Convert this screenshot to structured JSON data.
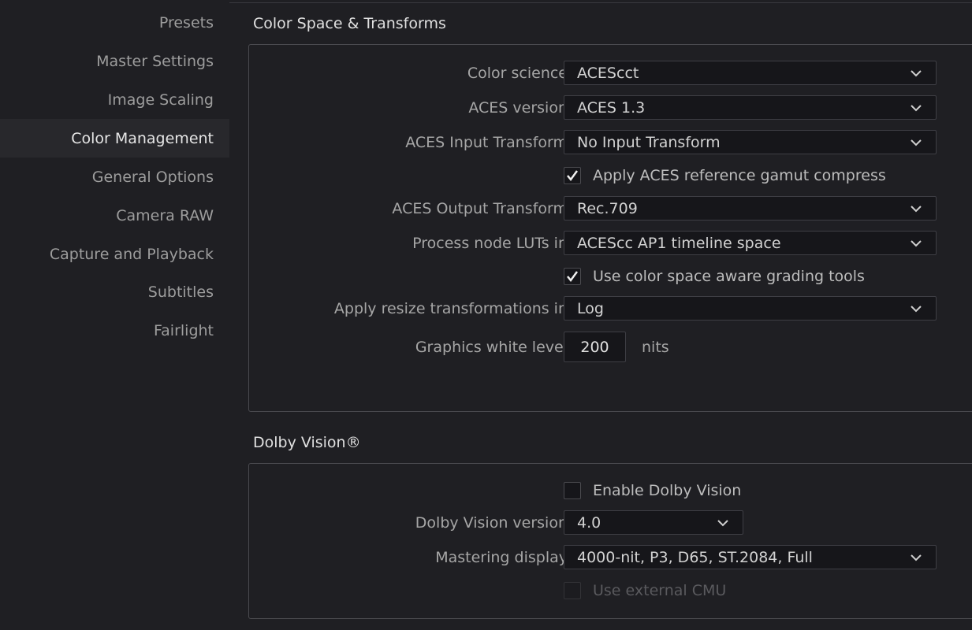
{
  "sidebar": {
    "items": [
      {
        "label": "Presets"
      },
      {
        "label": "Master Settings"
      },
      {
        "label": "Image Scaling"
      },
      {
        "label": "Color Management",
        "active": true
      },
      {
        "label": "General Options"
      },
      {
        "label": "Camera RAW"
      },
      {
        "label": "Capture and Playback"
      },
      {
        "label": "Subtitles"
      },
      {
        "label": "Fairlight"
      }
    ]
  },
  "color_space": {
    "title": "Color Space & Transforms",
    "color_science": {
      "label": "Color science",
      "value": "ACEScct"
    },
    "aces_version": {
      "label": "ACES version",
      "value": "ACES 1.3"
    },
    "aces_input": {
      "label": "ACES Input Transform",
      "value": "No Input Transform"
    },
    "gamut_compress": {
      "label": "Apply ACES reference gamut compress",
      "checked": true
    },
    "aces_output": {
      "label": "ACES Output Transform",
      "value": "Rec.709"
    },
    "process_luts": {
      "label": "Process node LUTs in",
      "value": "ACEScc AP1 timeline space"
    },
    "space_aware": {
      "label": "Use color space aware grading tools",
      "checked": true
    },
    "resize": {
      "label": "Apply resize transformations in",
      "value": "Log"
    },
    "white_level": {
      "label": "Graphics white level",
      "value": "200",
      "unit": "nits"
    }
  },
  "dolby": {
    "title": "Dolby Vision®",
    "enable": {
      "label": "Enable Dolby Vision",
      "checked": false
    },
    "version": {
      "label": "Dolby Vision version",
      "value": "4.0"
    },
    "mastering": {
      "label": "Mastering display",
      "value": "4000-nit, P3, D65, ST.2084, Full"
    },
    "external_cmu": {
      "label": "Use external CMU",
      "checked": false,
      "disabled": true
    }
  },
  "colors": {
    "background": "#1f1f23",
    "active_item": "#28282c",
    "field": "#16161a",
    "border": "#4a4a4f"
  }
}
